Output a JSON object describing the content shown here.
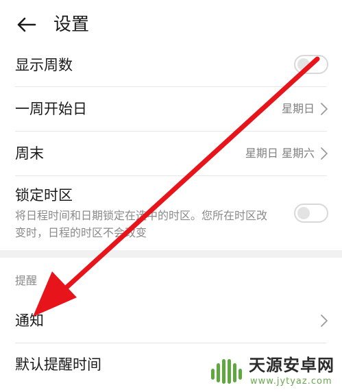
{
  "header": {
    "back_icon": "back-arrow-icon",
    "title": "设置"
  },
  "rows": {
    "show_week_number": {
      "label": "显示周数",
      "toggle_on": false
    },
    "week_start": {
      "label": "一周开始日",
      "value": "星期日"
    },
    "weekend": {
      "label": "周末",
      "value": "星期日 星期六"
    },
    "lock_timezone": {
      "label": "锁定时区",
      "description": "将日程时间和日期锁定在选中的时区。您所在时区改变时，日程的时区不会改变",
      "toggle_on": false
    }
  },
  "reminder_section": {
    "title": "提醒",
    "notification": {
      "label": "通知"
    },
    "default_reminder_time": {
      "label": "默认提醒时间"
    }
  },
  "annotation": {
    "arrow_color": "#e8141b",
    "points_to": "通知"
  },
  "watermark": {
    "name": "天源安卓网",
    "url": "www.jytyaz.com"
  },
  "colors": {
    "text_primary": "#1a1a1a",
    "text_secondary": "#808080",
    "divider": "#e6e6e6",
    "section_background": "#f1f1f1",
    "annotation_red": "#e8141b"
  }
}
